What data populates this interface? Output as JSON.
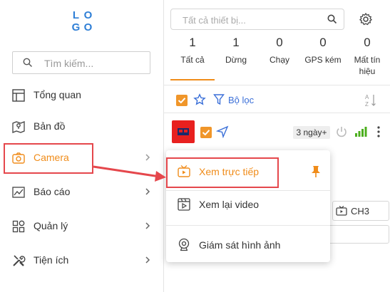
{
  "logo": {
    "letters": [
      "L",
      "O",
      "G",
      "O"
    ]
  },
  "sidebar": {
    "search_placeholder": "Tìm kiếm...",
    "items": [
      {
        "label": "Tổng quan",
        "icon": "dashboard-icon"
      },
      {
        "label": "Bản đồ",
        "icon": "map-icon"
      },
      {
        "label": "Camera",
        "icon": "camera-icon"
      },
      {
        "label": "Báo cáo",
        "icon": "chart-icon"
      },
      {
        "label": "Quản lý",
        "icon": "grid-icon"
      },
      {
        "label": "Tiện ích",
        "icon": "tools-icon"
      }
    ]
  },
  "device_panel": {
    "search_placeholder": "Tất cả thiết bị...",
    "stats": [
      {
        "count": "1",
        "label": "Tất cả"
      },
      {
        "count": "1",
        "label": "Dừng"
      },
      {
        "count": "0",
        "label": "Chạy"
      },
      {
        "count": "0",
        "label": "GPS kém"
      },
      {
        "count": "0",
        "label": "Mất tín hiệu"
      }
    ],
    "active_tab": "Tất cả",
    "filter_label": "Bộ lọc",
    "device": {
      "status_badge": "3 ngày+",
      "signal_bars": 4
    },
    "channel_button": "CH3"
  },
  "camera_menu": {
    "items": [
      {
        "label": "Xem trực tiếp",
        "icon": "live-tv-icon",
        "pinned": true
      },
      {
        "label": "Xem lại video",
        "icon": "video-replay-icon"
      },
      {
        "label": "Giám sát hình ảnh",
        "icon": "webcam-icon"
      }
    ]
  },
  "colors": {
    "accent": "#f08c1a",
    "highlight": "#e5474c",
    "link": "#3a6fd8",
    "device_red": "#e8201f",
    "signal_green": "#4caf1e",
    "logo_blue": "#2f7fd6"
  }
}
